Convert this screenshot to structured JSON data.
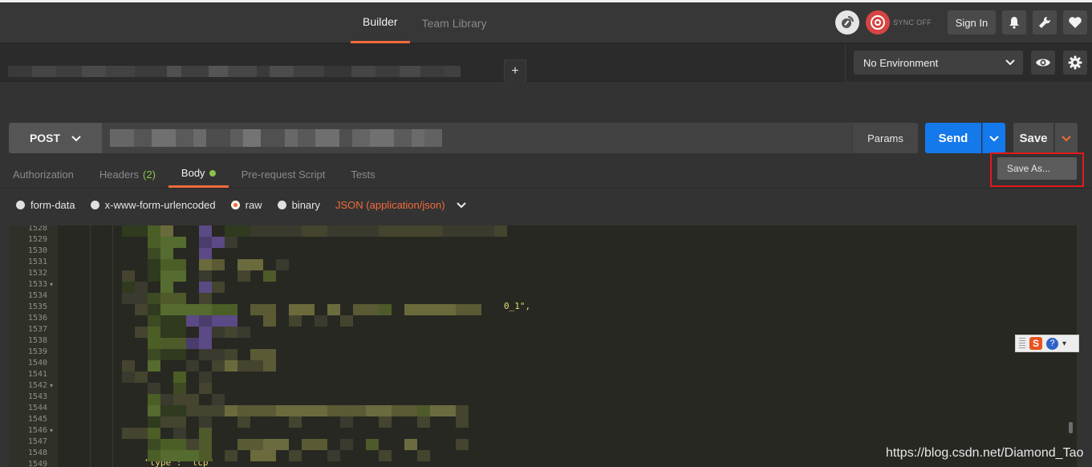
{
  "header": {
    "tabs": [
      {
        "label": "Builder",
        "active": true
      },
      {
        "label": "Team Library",
        "active": false
      }
    ],
    "sync_label": "SYNC OFF",
    "signin_label": "Sign In",
    "icons": [
      "satellite-icon",
      "sync-icon",
      "bell-icon",
      "wrench-icon",
      "heart-icon"
    ]
  },
  "tabstrip": {
    "new_tab_label": "+"
  },
  "environment": {
    "selected": "No Environment",
    "icons": [
      "eye-icon",
      "gear-icon"
    ]
  },
  "request": {
    "method": "POST",
    "params_label": "Params",
    "send_label": "Send",
    "save_label": "Save",
    "save_as_label": "Save As..."
  },
  "subtabs": [
    {
      "label": "Authorization",
      "active": false
    },
    {
      "label": "Headers",
      "count": "(2)",
      "active": false
    },
    {
      "label": "Body",
      "active": true,
      "dot": true
    },
    {
      "label": "Pre-request Script",
      "active": false
    },
    {
      "label": "Tests",
      "active": false
    }
  ],
  "body_options": [
    {
      "label": "form-data",
      "selected": false
    },
    {
      "label": "x-www-form-urlencoded",
      "selected": false
    },
    {
      "label": "raw",
      "selected": true
    },
    {
      "label": "binary",
      "selected": false
    }
  ],
  "content_type": "JSON (application/json)",
  "editor": {
    "line_numbers": [
      "1528",
      "1529",
      "1530",
      "1531",
      "1532",
      "1533",
      "1534",
      "1535",
      "1536",
      "1537",
      "1538",
      "1539",
      "1540",
      "1541",
      "1542",
      "1543",
      "1544",
      "1545",
      "1546",
      "1547",
      "1548",
      "1549"
    ],
    "folded_lines": [
      "1533",
      "1542",
      "1546"
    ],
    "visible_fragment_1535": "0_1\",",
    "visible_fragment_1549": "\"type\": \"tcp\""
  },
  "ime_toolbar": {
    "label": "S"
  },
  "watermark": "https://blog.csdn.net/Diamond_Tao",
  "colors": {
    "accent": "#f26b3a",
    "send_blue": "#1479ea",
    "green_badge": "#8bc34a",
    "highlight_red": "#e2191b"
  }
}
